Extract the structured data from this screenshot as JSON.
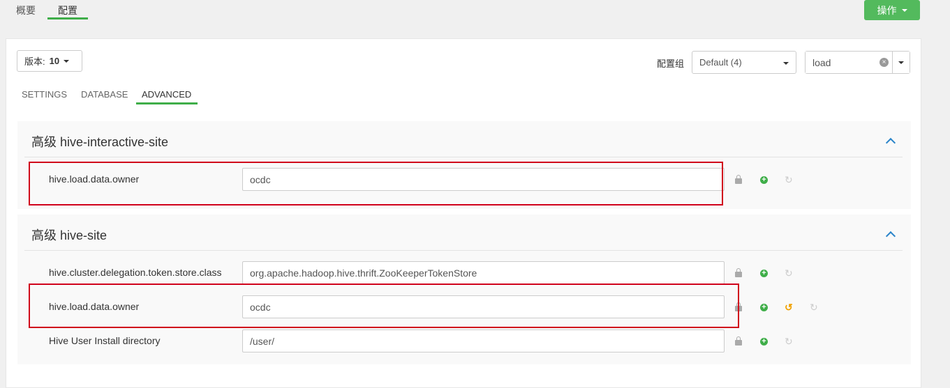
{
  "top_tabs": [
    {
      "label": "概要",
      "active": false
    },
    {
      "label": "配置",
      "active": true
    }
  ],
  "action_button": {
    "label": "操作"
  },
  "version": {
    "label": "版本:",
    "value": "10"
  },
  "config_group": {
    "label": "配置组",
    "selected": "Default (4)"
  },
  "filter": {
    "value": "load",
    "clear_icon": "×"
  },
  "sub_tabs": [
    {
      "label": "SETTINGS",
      "active": false
    },
    {
      "label": "DATABASE",
      "active": false
    },
    {
      "label": "ADVANCED",
      "active": true
    }
  ],
  "sections": [
    {
      "title": "高级 hive-interactive-site",
      "rows": [
        {
          "label": "hive.load.data.owner",
          "value": "ocdc",
          "highlighted": true,
          "undo": false
        }
      ]
    },
    {
      "title": "高级 hive-site",
      "rows": [
        {
          "label": "hive.cluster.delegation.token.store.class",
          "value": "org.apache.hadoop.hive.thrift.ZooKeeperTokenStore",
          "highlighted": false,
          "undo": false
        },
        {
          "label": "hive.load.data.owner",
          "value": "ocdc",
          "highlighted": true,
          "undo": true
        },
        {
          "label": "Hive User Install directory",
          "value": "/user/",
          "highlighted": false,
          "undo": false
        }
      ]
    }
  ],
  "colors": {
    "accent": "#3fae49",
    "action": "#53ba5d",
    "highlight": "#d0021b",
    "undo": "#f0a000",
    "chevron": "#2a84c9"
  },
  "icons": {
    "lock": "lock-icon",
    "plus": "plus-circle-icon",
    "refresh": "refresh-icon",
    "undo": "undo-icon"
  }
}
